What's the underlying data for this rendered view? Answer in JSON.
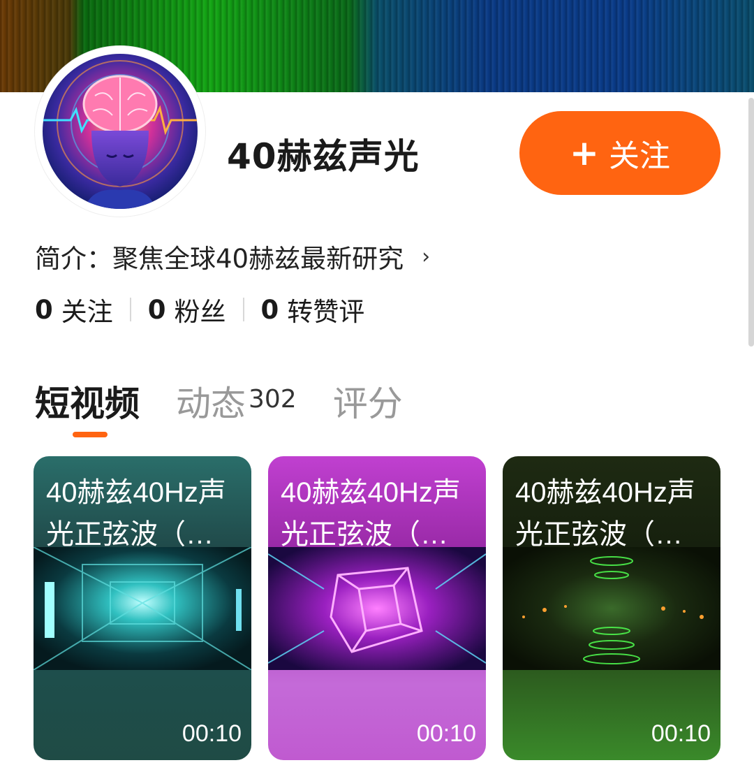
{
  "profile": {
    "name": "40赫兹声光",
    "follow_label": "关注",
    "bio": "简介：聚焦全球40赫兹最新研究"
  },
  "stats": [
    {
      "value": "0",
      "label": "关注"
    },
    {
      "value": "0",
      "label": "粉丝"
    },
    {
      "value": "0",
      "label": "转赞评"
    }
  ],
  "tabs": [
    {
      "label": "短视频",
      "count": ""
    },
    {
      "label": "动态",
      "count": "302"
    },
    {
      "label": "评分",
      "count": ""
    }
  ],
  "videos": [
    {
      "title": "40赫兹40Hz声光正弦波（…",
      "duration": "00:10"
    },
    {
      "title": "40赫兹40Hz声光正弦波（…",
      "duration": "00:10"
    },
    {
      "title": "40赫兹40Hz声光正弦波（…",
      "duration": "00:10"
    }
  ],
  "colors": {
    "accent": "#ff6411"
  }
}
